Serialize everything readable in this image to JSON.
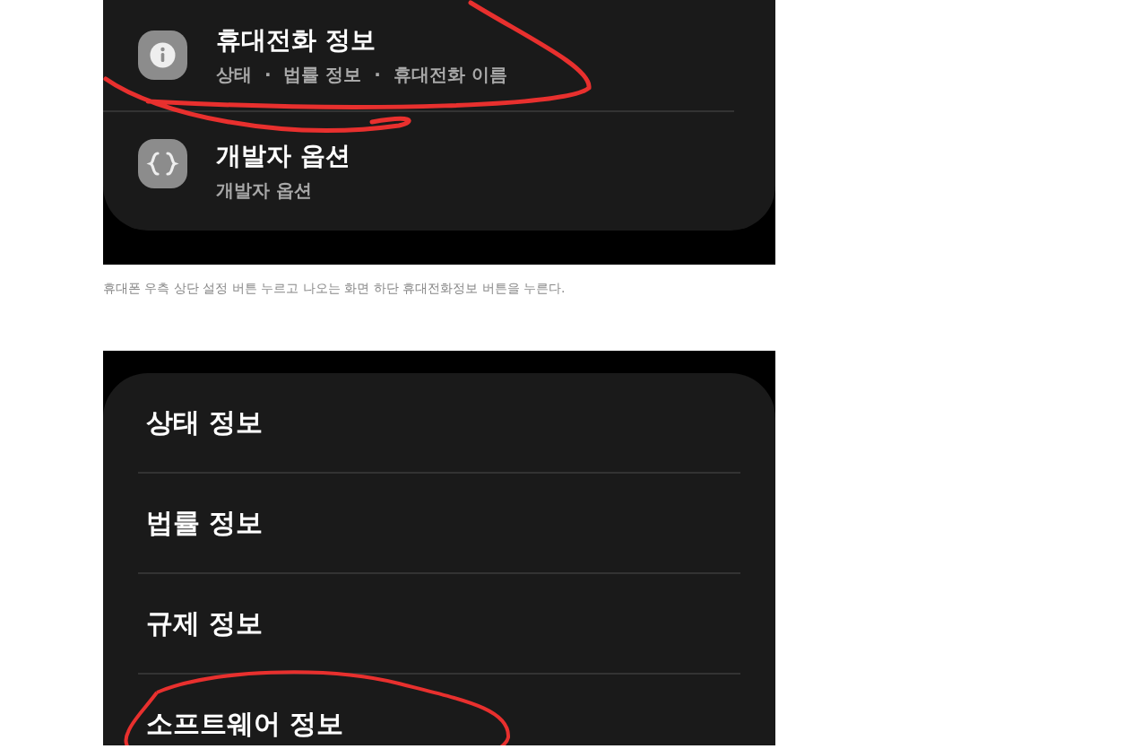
{
  "screenshots": [
    {
      "kind": "icon_list",
      "items": [
        {
          "title": "휴대전화 정보",
          "subtitle": "상태  ·  법률 정보  ·  휴대전화 이름",
          "circled": true
        },
        {
          "title": "개발자 옵션",
          "subtitle": "개발자 옵션",
          "circled": false
        }
      ],
      "caption": "휴대폰 우측 상단 설정 버튼 누르고 나오는 화면 하단 휴대전화정보 버튼을 누른다."
    },
    {
      "kind": "plain_list",
      "items": [
        {
          "title": "상태 정보",
          "circled": false
        },
        {
          "title": "법률 정보",
          "circled": false
        },
        {
          "title": "규제 정보",
          "circled": false
        },
        {
          "title": "소프트웨어 정보",
          "circled": true
        }
      ]
    }
  ]
}
